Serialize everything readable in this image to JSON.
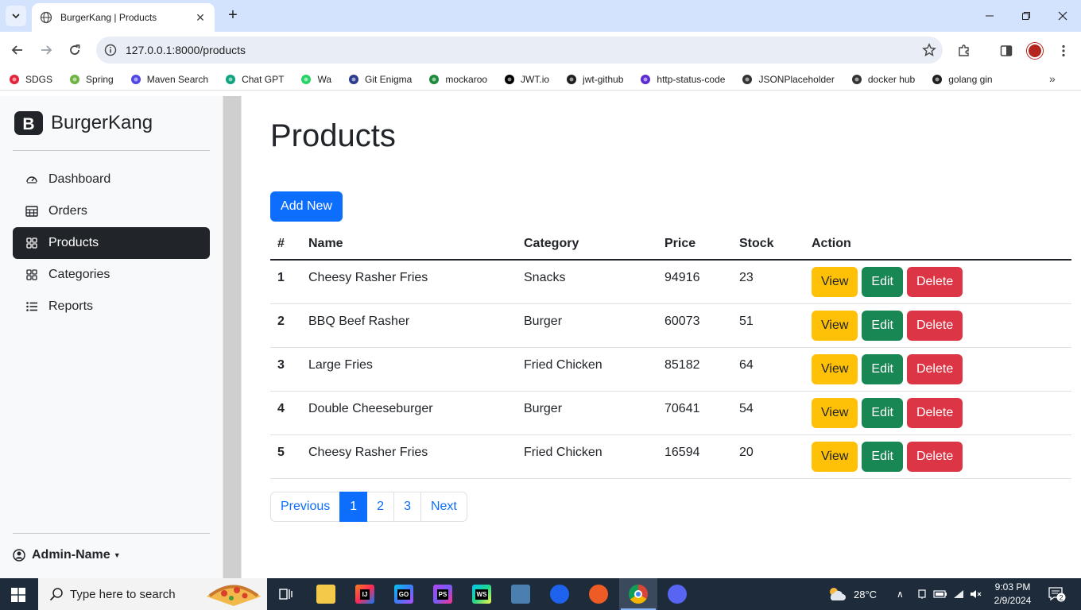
{
  "browser": {
    "tab_title": "BurgerKang | Products",
    "url": "127.0.0.1:8000/products",
    "bookmarks": [
      {
        "label": "SDGS",
        "icon": "sdgs-icon",
        "color": "#e5243b"
      },
      {
        "label": "Spring",
        "icon": "spring-icon",
        "color": "#6db33f"
      },
      {
        "label": "Maven Search",
        "icon": "maven-icon",
        "color": "#4f46e5"
      },
      {
        "label": "Chat GPT",
        "icon": "chatgpt-icon",
        "color": "#10a37f"
      },
      {
        "label": "Wa",
        "icon": "whatsapp-icon",
        "color": "#25d366"
      },
      {
        "label": "Git Enigma",
        "icon": "git-enigma-icon",
        "color": "#2b3a8c"
      },
      {
        "label": "mockaroo",
        "icon": "mockaroo-icon",
        "color": "#1b8a3a"
      },
      {
        "label": "JWT.io",
        "icon": "jwt-icon",
        "color": "#000000"
      },
      {
        "label": "jwt-github",
        "icon": "github-icon",
        "color": "#1f1f1f"
      },
      {
        "label": "http-status-code",
        "icon": "http-status-icon",
        "color": "#5b2ccf"
      },
      {
        "label": "JSONPlaceholder",
        "icon": "jsonplaceholder-icon",
        "color": "#333333"
      },
      {
        "label": "docker hub",
        "icon": "dockerhub-icon",
        "color": "#333333"
      },
      {
        "label": "golang gin",
        "icon": "github-icon",
        "color": "#1f1f1f"
      }
    ]
  },
  "sidebar": {
    "brand": "BurgerKang",
    "items": [
      {
        "label": "Dashboard",
        "icon": "speedometer-icon",
        "active": false
      },
      {
        "label": "Orders",
        "icon": "table-icon",
        "active": false
      },
      {
        "label": "Products",
        "icon": "grid-icon",
        "active": true
      },
      {
        "label": "Categories",
        "icon": "grid-icon",
        "active": false
      },
      {
        "label": "Reports",
        "icon": "list-icon",
        "active": false
      }
    ],
    "user": "Admin-Name"
  },
  "main": {
    "title": "Products",
    "add_new_label": "Add New",
    "table": {
      "headers": [
        "#",
        "Name",
        "Category",
        "Price",
        "Stock",
        "Action"
      ],
      "rows": [
        {
          "no": "1",
          "name": "Cheesy Rasher Fries",
          "category": "Snacks",
          "price": "94916",
          "stock": "23"
        },
        {
          "no": "2",
          "name": "BBQ Beef Rasher",
          "category": "Burger",
          "price": "60073",
          "stock": "51"
        },
        {
          "no": "3",
          "name": "Large Fries",
          "category": "Fried Chicken",
          "price": "85182",
          "stock": "64"
        },
        {
          "no": "4",
          "name": "Double Cheeseburger",
          "category": "Burger",
          "price": "70641",
          "stock": "54"
        },
        {
          "no": "5",
          "name": "Cheesy Rasher Fries",
          "category": "Fried Chicken",
          "price": "16594",
          "stock": "20"
        }
      ],
      "actions": {
        "view": "View",
        "edit": "Edit",
        "delete": "Delete"
      }
    },
    "pagination": {
      "previous": "Previous",
      "pages": [
        "1",
        "2",
        "3"
      ],
      "current": "1",
      "next": "Next"
    }
  },
  "taskbar": {
    "search_placeholder": "Type here to search",
    "temperature": "28°C",
    "time": "9:03 PM",
    "date": "2/9/2024",
    "notifications": "2"
  },
  "colors": {
    "primary": "#0d6efd",
    "warning": "#ffc107",
    "success": "#198754",
    "danger": "#dc3545",
    "dark": "#212529"
  }
}
